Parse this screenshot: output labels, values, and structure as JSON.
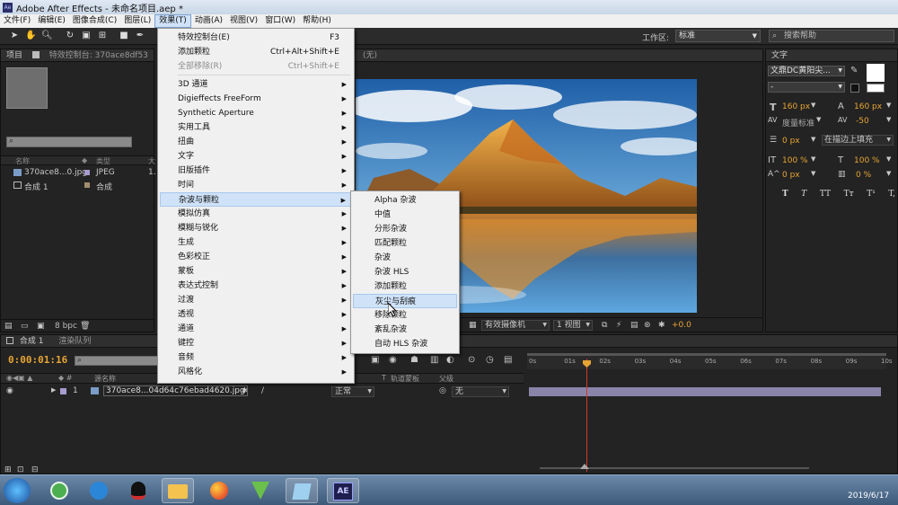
{
  "window": {
    "title": "Adobe After Effects - 未命名项目.aep *"
  },
  "menubar": [
    "文件(F)",
    "编辑(E)",
    "图像合成(C)",
    "图层(L)",
    "效果(T)",
    "动画(A)",
    "视图(V)",
    "窗口(W)",
    "帮助(H)"
  ],
  "toolbar": {
    "workspace_label": "工作区:",
    "workspace_value": "标准",
    "search_placeholder": "搜索帮助"
  },
  "project_panel": {
    "tab_project": "项目",
    "tab_effects": "特效控制台: 370ace8df53",
    "col_name": "名称",
    "col_type": "类型",
    "col_size": "大",
    "items": [
      {
        "name": "370ace8...0.jpg",
        "type": "JPEG",
        "size": "1."
      },
      {
        "name": "合成 1",
        "type": "合成",
        "size": ""
      }
    ],
    "bpc": "8 bpc"
  },
  "viewer": {
    "tab_suffix": "(无)",
    "camera": "有效摄像机",
    "views": "1 视图",
    "exposure": "+0.0"
  },
  "effects_menu": {
    "items": [
      {
        "label": "特效控制台(E)",
        "shortcut": "F3"
      },
      {
        "label": "添加颗粒",
        "shortcut": "Ctrl+Alt+Shift+E"
      },
      {
        "label": "全部移除(R)",
        "shortcut": "Ctrl+Shift+E",
        "disabled": true
      },
      {
        "label": "3D 通道",
        "arrow": "▶"
      },
      {
        "label": "Digieffects FreeForm",
        "arrow": "▶"
      },
      {
        "label": "Synthetic Aperture",
        "arrow": "▶"
      },
      {
        "label": "实用工具",
        "arrow": "▶"
      },
      {
        "label": "扭曲",
        "arrow": "▶"
      },
      {
        "label": "文字",
        "arrow": "▶"
      },
      {
        "label": "旧版插件",
        "arrow": "▶"
      },
      {
        "label": "时间",
        "arrow": "▶"
      },
      {
        "label": "杂波与颗粒",
        "arrow": "▶",
        "highlighted": true
      },
      {
        "label": "模拟仿真",
        "arrow": "▶"
      },
      {
        "label": "模糊与锐化",
        "arrow": "▶"
      },
      {
        "label": "生成",
        "arrow": "▶"
      },
      {
        "label": "色彩校正",
        "arrow": "▶"
      },
      {
        "label": "蒙板",
        "arrow": "▶"
      },
      {
        "label": "表达式控制",
        "arrow": "▶"
      },
      {
        "label": "过渡",
        "arrow": "▶"
      },
      {
        "label": "透视",
        "arrow": "▶"
      },
      {
        "label": "通道",
        "arrow": "▶"
      },
      {
        "label": "键控",
        "arrow": "▶"
      },
      {
        "label": "音频",
        "arrow": "▶"
      },
      {
        "label": "风格化",
        "arrow": "▶"
      }
    ]
  },
  "noise_submenu": [
    "Alpha 杂波",
    "中值",
    "分形杂波",
    "匹配颗粒",
    "杂波",
    "杂波 HLS",
    "添加颗粒",
    "灰尘与刮痕",
    "移除颗粒",
    "紊乱杂波",
    "自动 HLS 杂波"
  ],
  "noise_submenu_highlighted": "灰尘与刮痕",
  "text_panel": {
    "tab": "文字",
    "font": "文鼎DC黄阳尖...",
    "style": "-",
    "size": "160 px",
    "leading": "160 px",
    "kerning": "度量标准",
    "tracking": "-50",
    "stroke": "0 px",
    "stroke_mode": "在描边上填充",
    "vscale": "100 %",
    "hscale": "100 %",
    "baseline": "0 px",
    "tsume": "0 %",
    "format_buttons": [
      "T",
      "T",
      "TT",
      "Tт",
      "T¹",
      "T,"
    ]
  },
  "timeline": {
    "tab_comp": "合成 1",
    "tab_render": "渲染队列",
    "timecode": "0:00:01:16",
    "col_layer": "源名称",
    "col_mode": "模式",
    "col_t": "T",
    "col_trkmat": "轨道蒙板",
    "col_parent": "父级",
    "layer_number": "1",
    "layer_name": "370ace8...04d64c76ebad4620.jpg",
    "layer_mode": "正常",
    "layer_parent": "无",
    "ruler": [
      "0s",
      "01s",
      "02s",
      "03s",
      "04s",
      "05s",
      "06s",
      "07s",
      "08s",
      "09s",
      "10s"
    ]
  },
  "taskbar": {
    "ae_label": "AE",
    "date": "2019/6/17"
  }
}
